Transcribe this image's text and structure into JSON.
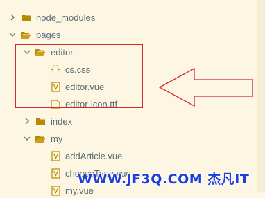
{
  "explorer": {
    "items": [
      {
        "label": "node_modules",
        "expanded": false
      },
      {
        "label": "pages",
        "expanded": true
      },
      {
        "label": "editor",
        "expanded": true
      },
      {
        "label": "cs.css",
        "icon": "css-icon"
      },
      {
        "label": "editor.vue",
        "icon": "vue-file-icon"
      },
      {
        "label": "editor-icon.ttf",
        "icon": "font-file-icon"
      },
      {
        "label": "index",
        "expanded": false
      },
      {
        "label": "my",
        "expanded": true
      },
      {
        "label": "addArticle.vue",
        "icon": "vue-file-icon"
      },
      {
        "label": "chooseType.vue",
        "icon": "vue-file-icon"
      },
      {
        "label": "my.vue",
        "icon": "vue-file-icon"
      }
    ]
  },
  "annotation": {
    "box_color": "#d9262b",
    "arrow_color": "#d9262b"
  },
  "watermark": {
    "text": "WWW.JF3Q.COM 杰凡IT"
  },
  "colors": {
    "background": "#fdf6e3",
    "text": "#586e75",
    "folder": "#b58900",
    "file_outline": "#b58900"
  }
}
